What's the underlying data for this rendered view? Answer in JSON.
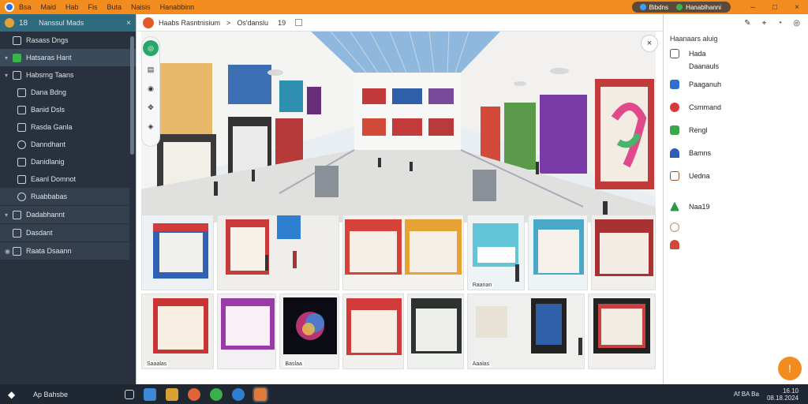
{
  "menubar": {
    "items": [
      "Bsa",
      "Maid",
      "Hab",
      "Fis",
      "Buta",
      "Naisis",
      "Hanabbinn"
    ],
    "pill_left": "Bibdns",
    "pill_right": "Hanablhanni"
  },
  "sidebar": {
    "header_logo": "18",
    "header_title": "Nanssul Mads",
    "items": [
      {
        "label": "Rasass Dngs",
        "chev": ""
      },
      {
        "label": "Hatsaras Hant",
        "chev": "▾"
      },
      {
        "label": "Habsrng Taans",
        "chev": "▾"
      },
      {
        "label": "Dana Bdng",
        "chev": ""
      },
      {
        "label": "Banid Dsls",
        "chev": ""
      },
      {
        "label": "Rasda Ganla",
        "chev": ""
      },
      {
        "label": "Danndhant",
        "chev": ""
      },
      {
        "label": "Danidlanig",
        "chev": ""
      },
      {
        "label": "Eaanl Domnot",
        "chev": ""
      },
      {
        "label": "Ruabbabas",
        "chev": ""
      },
      {
        "label": "Dadabhannt",
        "chev": "▾"
      },
      {
        "label": "Dasdant",
        "chev": ""
      },
      {
        "label": "Raata Dsaann",
        "chev": ""
      }
    ]
  },
  "breadcrumb": {
    "path": "Haabs Rasntnisium",
    "sep": ">",
    "secondary": "Os'danslu",
    "num": "19"
  },
  "grid": {
    "captions": [
      "Saaalas",
      "Raanan",
      "Aaalas",
      "Baslaa"
    ]
  },
  "rpanel": {
    "title": "Haanaars  aluig",
    "items": [
      {
        "label": "Hada"
      },
      {
        "label": "Daanauls"
      },
      {
        "label": "Paaganuh"
      },
      {
        "label": "Csmmand"
      },
      {
        "label": "Rengl"
      },
      {
        "label": "Bamns"
      },
      {
        "label": "Uedna"
      },
      {
        "label": "Naa19"
      }
    ],
    "fab": "!"
  },
  "taskbar": {
    "search": "Ap Bahsbe",
    "clock_time": "16.10",
    "clock_date": "08.18.2024",
    "tray": "Af  BA  Ba"
  },
  "colors": {
    "accent": "#f28c1f",
    "sidebar_bg": "#28313d",
    "taskbar_bg": "#1f2733"
  }
}
